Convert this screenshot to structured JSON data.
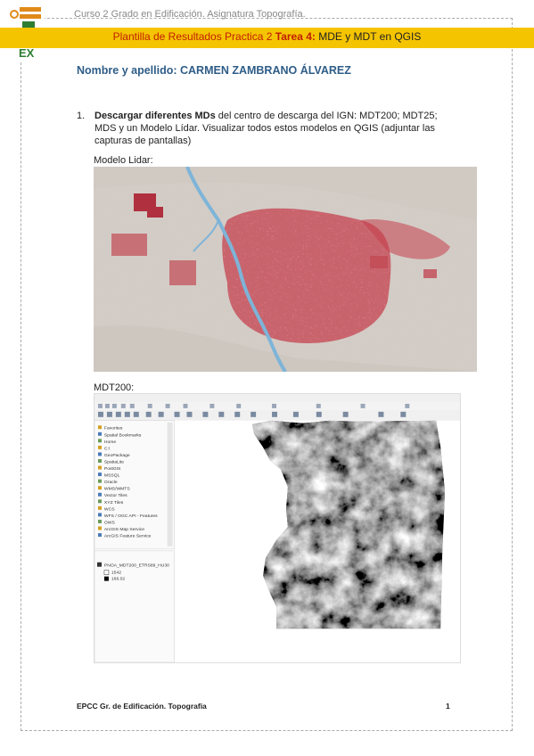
{
  "header": {
    "course": "Curso 2 Grado en Edificación. Asignatura Topografía.",
    "title_prefix": "Plantilla de Resultados Practica 2 ",
    "title_task": "Tarea 4:",
    "title_rest": " MDE y MDT en QGIS",
    "logo_text": "EX"
  },
  "student": {
    "name_line": "Nombre y apellido: CARMEN ZAMBRANO ÁLVAREZ"
  },
  "items": [
    {
      "number": "1.",
      "bold": "Descargar diferentes MDs",
      "text": " del centro de descarga del IGN: MDT200; MDT25; MDS y un Modelo Lídar. Visualizar todos estos modelos en QGIS (adjuntar las capturas de pantallas)"
    }
  ],
  "figures": {
    "lidar_caption": "Modelo Lidar:",
    "mdt_caption": "MDT200:"
  },
  "qgis": {
    "browser_items": [
      "Favorites",
      "Spatial Bookmarks",
      "Home",
      "C:\\",
      "GeoPackage",
      "SpatiaLite",
      "PostGIS",
      "MSSQL",
      "Oracle",
      "WMS/WMTS",
      "Vector Tiles",
      "XYZ Tiles",
      "WCS",
      "WFS / OGC API - Features",
      "OWS",
      "ArcGIS Map Service",
      "ArcGIS Feature Service"
    ],
    "layer_name": "PNOA_MDT200_ETRS89_HU30",
    "legend_high": "1542",
    "legend_low": "166.02"
  },
  "footer": {
    "left": "EPCC Gr. de Edificación. Topografia",
    "page": "1"
  },
  "colors": {
    "band": "#f5c400",
    "title_red": "#c02000",
    "name_blue": "#2f5d87"
  }
}
